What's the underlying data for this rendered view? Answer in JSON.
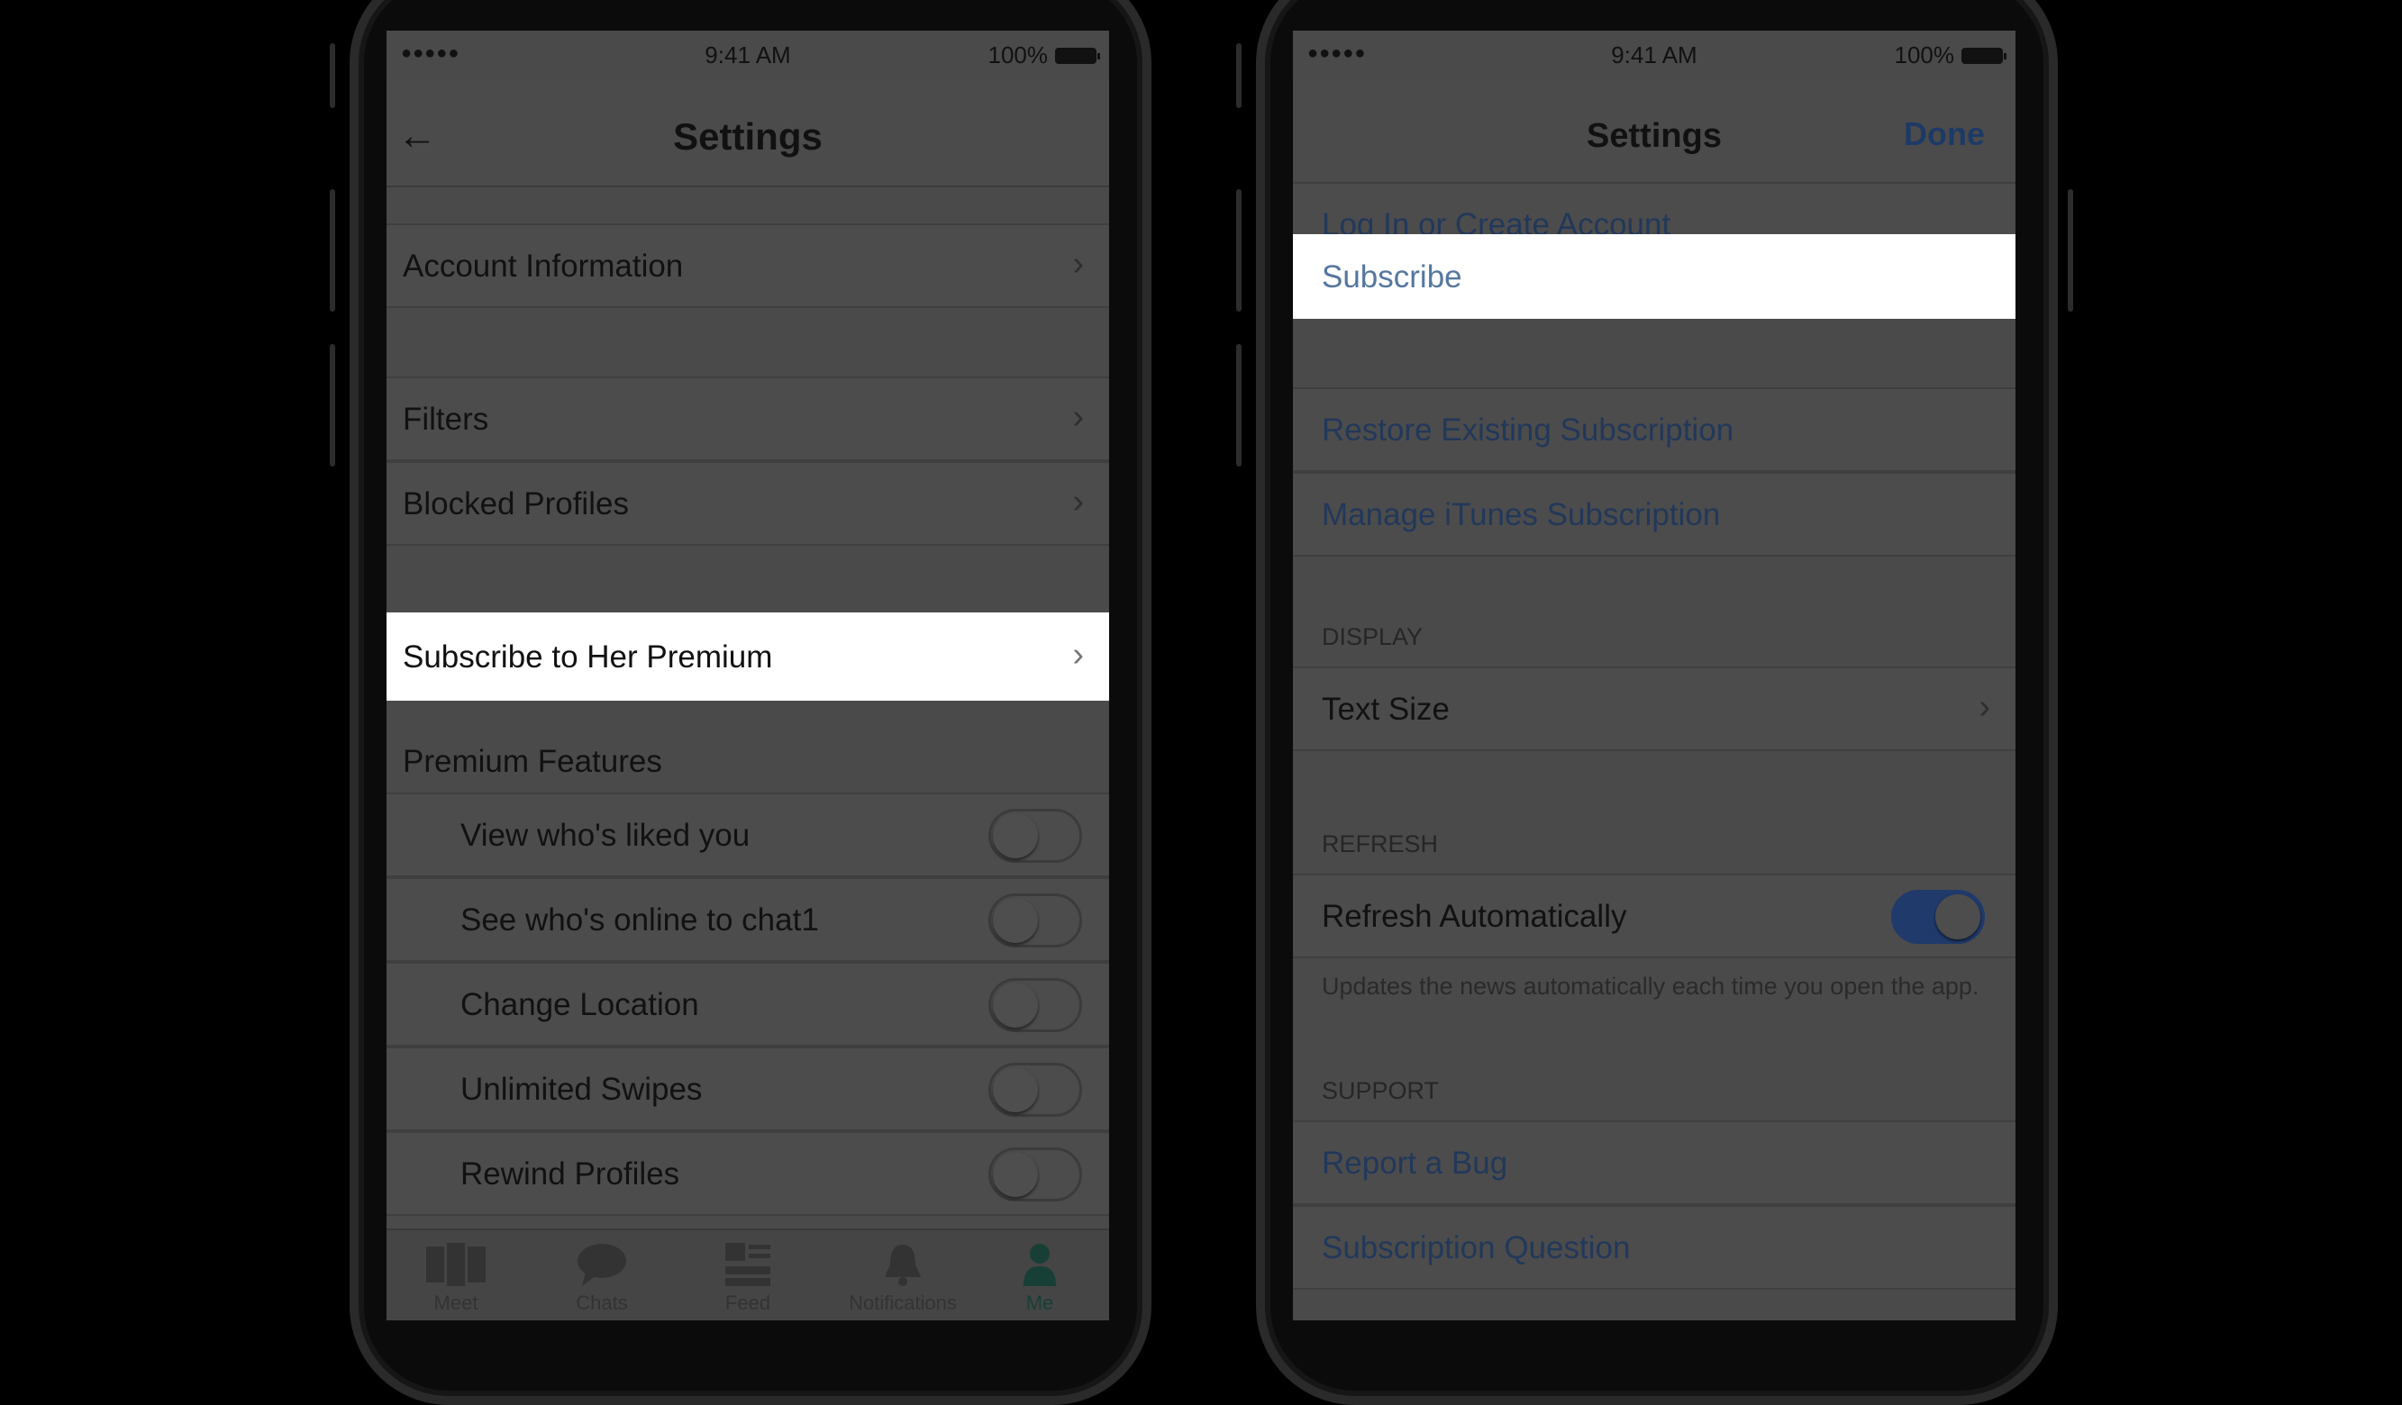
{
  "status": {
    "signal": "●●●●●",
    "time": "9:41 AM",
    "battery": "100%"
  },
  "left": {
    "title": "Settings",
    "rows": {
      "account": "Account Information",
      "filters": "Filters",
      "blocked": "Blocked Profiles",
      "subscribe": "Subscribe to Her Premium"
    },
    "premium_header": "Premium Features",
    "features": [
      {
        "label": "View who's liked you",
        "on": false
      },
      {
        "label": "See who's online to chat1",
        "on": false
      },
      {
        "label": "Change Location",
        "on": false
      },
      {
        "label": "Unlimited Swipes",
        "on": false
      },
      {
        "label": "Rewind Profiles",
        "on": false
      }
    ],
    "tabs": [
      "Meet",
      "Chats",
      "Feed",
      "Notifications",
      "Me"
    ],
    "active_tab": "Me",
    "icons": [
      "meet-icon",
      "chats-icon",
      "feed-icon",
      "notifications-icon",
      "me-icon"
    ]
  },
  "right": {
    "title": "Settings",
    "done": "Done",
    "rows": {
      "login": "Log In or Create Account",
      "subscribe": "Subscribe",
      "restore": "Restore Existing Subscription",
      "manage": "Manage iTunes Subscription",
      "text_size": "Text Size",
      "refresh": "Refresh Automatically",
      "bug": "Report a Bug",
      "question": "Subscription Question"
    },
    "sections": {
      "display": "DISPLAY",
      "refresh": "REFRESH",
      "support": "SUPPORT"
    },
    "refresh_on": true,
    "refresh_note": "Updates the news automatically each time you open the app."
  },
  "colors": {
    "accent_blue": "#203a6b",
    "active_tab": "#173f36",
    "highlight": "#ffffff"
  }
}
